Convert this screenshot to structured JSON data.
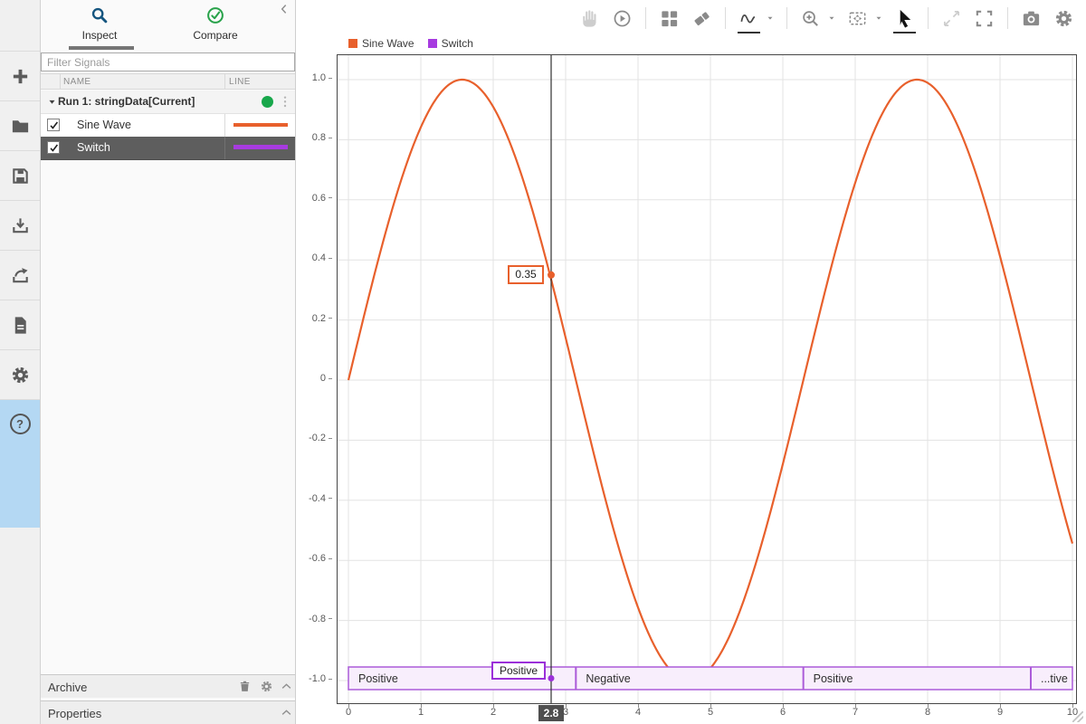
{
  "sidebar": {
    "help_glyph": "?",
    "items": [
      {
        "id": "add",
        "icon": "plus-icon"
      },
      {
        "id": "open",
        "icon": "folder-icon"
      },
      {
        "id": "save",
        "icon": "save-icon"
      },
      {
        "id": "import",
        "icon": "import-icon"
      },
      {
        "id": "export",
        "icon": "export-icon"
      },
      {
        "id": "report",
        "icon": "report-icon"
      },
      {
        "id": "preferences",
        "icon": "gear-icon"
      },
      {
        "id": "help",
        "icon": "help-icon",
        "active": true
      }
    ]
  },
  "panel": {
    "tabs": [
      {
        "label": "Inspect",
        "icon": "magnifier-icon",
        "active": true
      },
      {
        "label": "Compare",
        "icon": "check-circle-icon",
        "active": false
      }
    ],
    "filter": {
      "placeholder": "Filter Signals",
      "value": ""
    },
    "table": {
      "columns": [
        "NAME",
        "LINE"
      ],
      "run": {
        "label": "Run 1: stringData[Current]",
        "expanded": true,
        "status_dot_color": "#18a74b"
      },
      "signals": [
        {
          "name": "Sine Wave",
          "checked": true,
          "line_color": "#e8602c",
          "selected": false
        },
        {
          "name": "Switch",
          "checked": true,
          "line_color": "#a73be0",
          "selected": true
        }
      ]
    },
    "archive": {
      "label": "Archive",
      "icons": [
        "trash-icon",
        "gear-icon",
        "chevron-up-icon"
      ]
    },
    "properties": {
      "label": "Properties",
      "icons": [
        "chevron-up-icon"
      ]
    }
  },
  "toolbar": {
    "buttons": [
      "pan",
      "replay",
      "layout",
      "eraser",
      "signal-cursor",
      "zoom-in",
      "fit-to-view",
      "pointer",
      "expand",
      "fullscreen",
      "snapshot",
      "settings"
    ],
    "disabled": [
      "pan",
      "expand"
    ],
    "underlined": [
      "signal-cursor",
      "pointer"
    ]
  },
  "chart_data": {
    "type": "line",
    "x_range": [
      0,
      10
    ],
    "x_ticks": [
      "0",
      "1",
      "2",
      "3",
      "4",
      "5",
      "6",
      "7",
      "8",
      "9",
      "10"
    ],
    "y_ticks": [
      "1.0",
      "0.8",
      "0.6",
      "0.4",
      "0.2",
      "0",
      "-0.2",
      "-0.4",
      "-0.6",
      "-0.8",
      "-1.0"
    ],
    "grid": true,
    "legend": {
      "position": "top-left",
      "entries": [
        {
          "label": "Sine Wave",
          "color": "#e8602c"
        },
        {
          "label": "Switch",
          "color": "#a73be0"
        }
      ]
    },
    "series": [
      {
        "name": "Sine Wave",
        "type": "line",
        "color": "#e8602c",
        "waveform": "sine",
        "amplitude": 1,
        "angular_frequency": 1,
        "phase": 0,
        "t_start": 0,
        "t_end": 10
      },
      {
        "name": "Switch",
        "type": "string-bands",
        "color": "#9b30d9",
        "band_fill": "#f8eefc",
        "band_border": "#ab5bd9",
        "baseline": -1,
        "segments": [
          {
            "value": "Positive",
            "display": "Positive",
            "t_start": 0,
            "t_end": 3.1416
          },
          {
            "value": "Negative",
            "display": "Negative",
            "t_start": 3.1416,
            "t_end": 6.2832
          },
          {
            "value": "Positive",
            "display": "Positive",
            "t_start": 6.2832,
            "t_end": 9.4248
          },
          {
            "value": "Negative",
            "display": "...tive",
            "t_start": 9.4248,
            "t_end": 10
          }
        ]
      }
    ],
    "cursor": {
      "t": 2.8,
      "t_label": "2.8",
      "sine_value_label": "0.35",
      "switch_value_label": "Positive"
    }
  }
}
